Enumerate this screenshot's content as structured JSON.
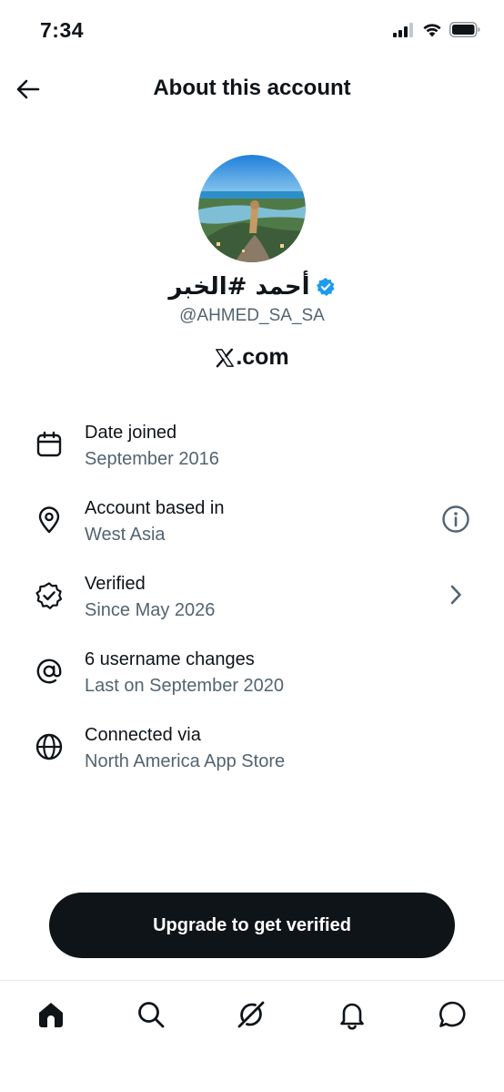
{
  "status_bar": {
    "time": "7:34"
  },
  "header": {
    "title": "About this account"
  },
  "profile": {
    "display_name": "أحمد #الخبر",
    "handle": "@AHMED_SA_SA",
    "verified": true,
    "site": ".com"
  },
  "info": [
    {
      "title": "Date joined",
      "subtitle": "September 2016",
      "icon": "calendar-icon"
    },
    {
      "title": "Account based in",
      "subtitle": "West Asia",
      "icon": "location-pin-icon",
      "action": "info-icon"
    },
    {
      "title": "Verified",
      "subtitle": "Since May 2026",
      "icon": "verified-badge-icon",
      "action": "chevron-right-icon"
    },
    {
      "title": "6 username changes",
      "subtitle": "Last on September 2020",
      "icon": "at-sign-icon"
    },
    {
      "title": "Connected via",
      "subtitle": "North America App Store",
      "icon": "globe-icon"
    }
  ],
  "cta": {
    "label": "Upgrade to get verified"
  },
  "nav": [
    "home-icon",
    "search-icon",
    "grok-icon",
    "notifications-bell-icon",
    "messages-icon"
  ],
  "colors": {
    "primary": "#0f1419",
    "secondary_text": "#536471",
    "verified_blue": "#1d9bf0",
    "divider": "#e6e9ec"
  }
}
